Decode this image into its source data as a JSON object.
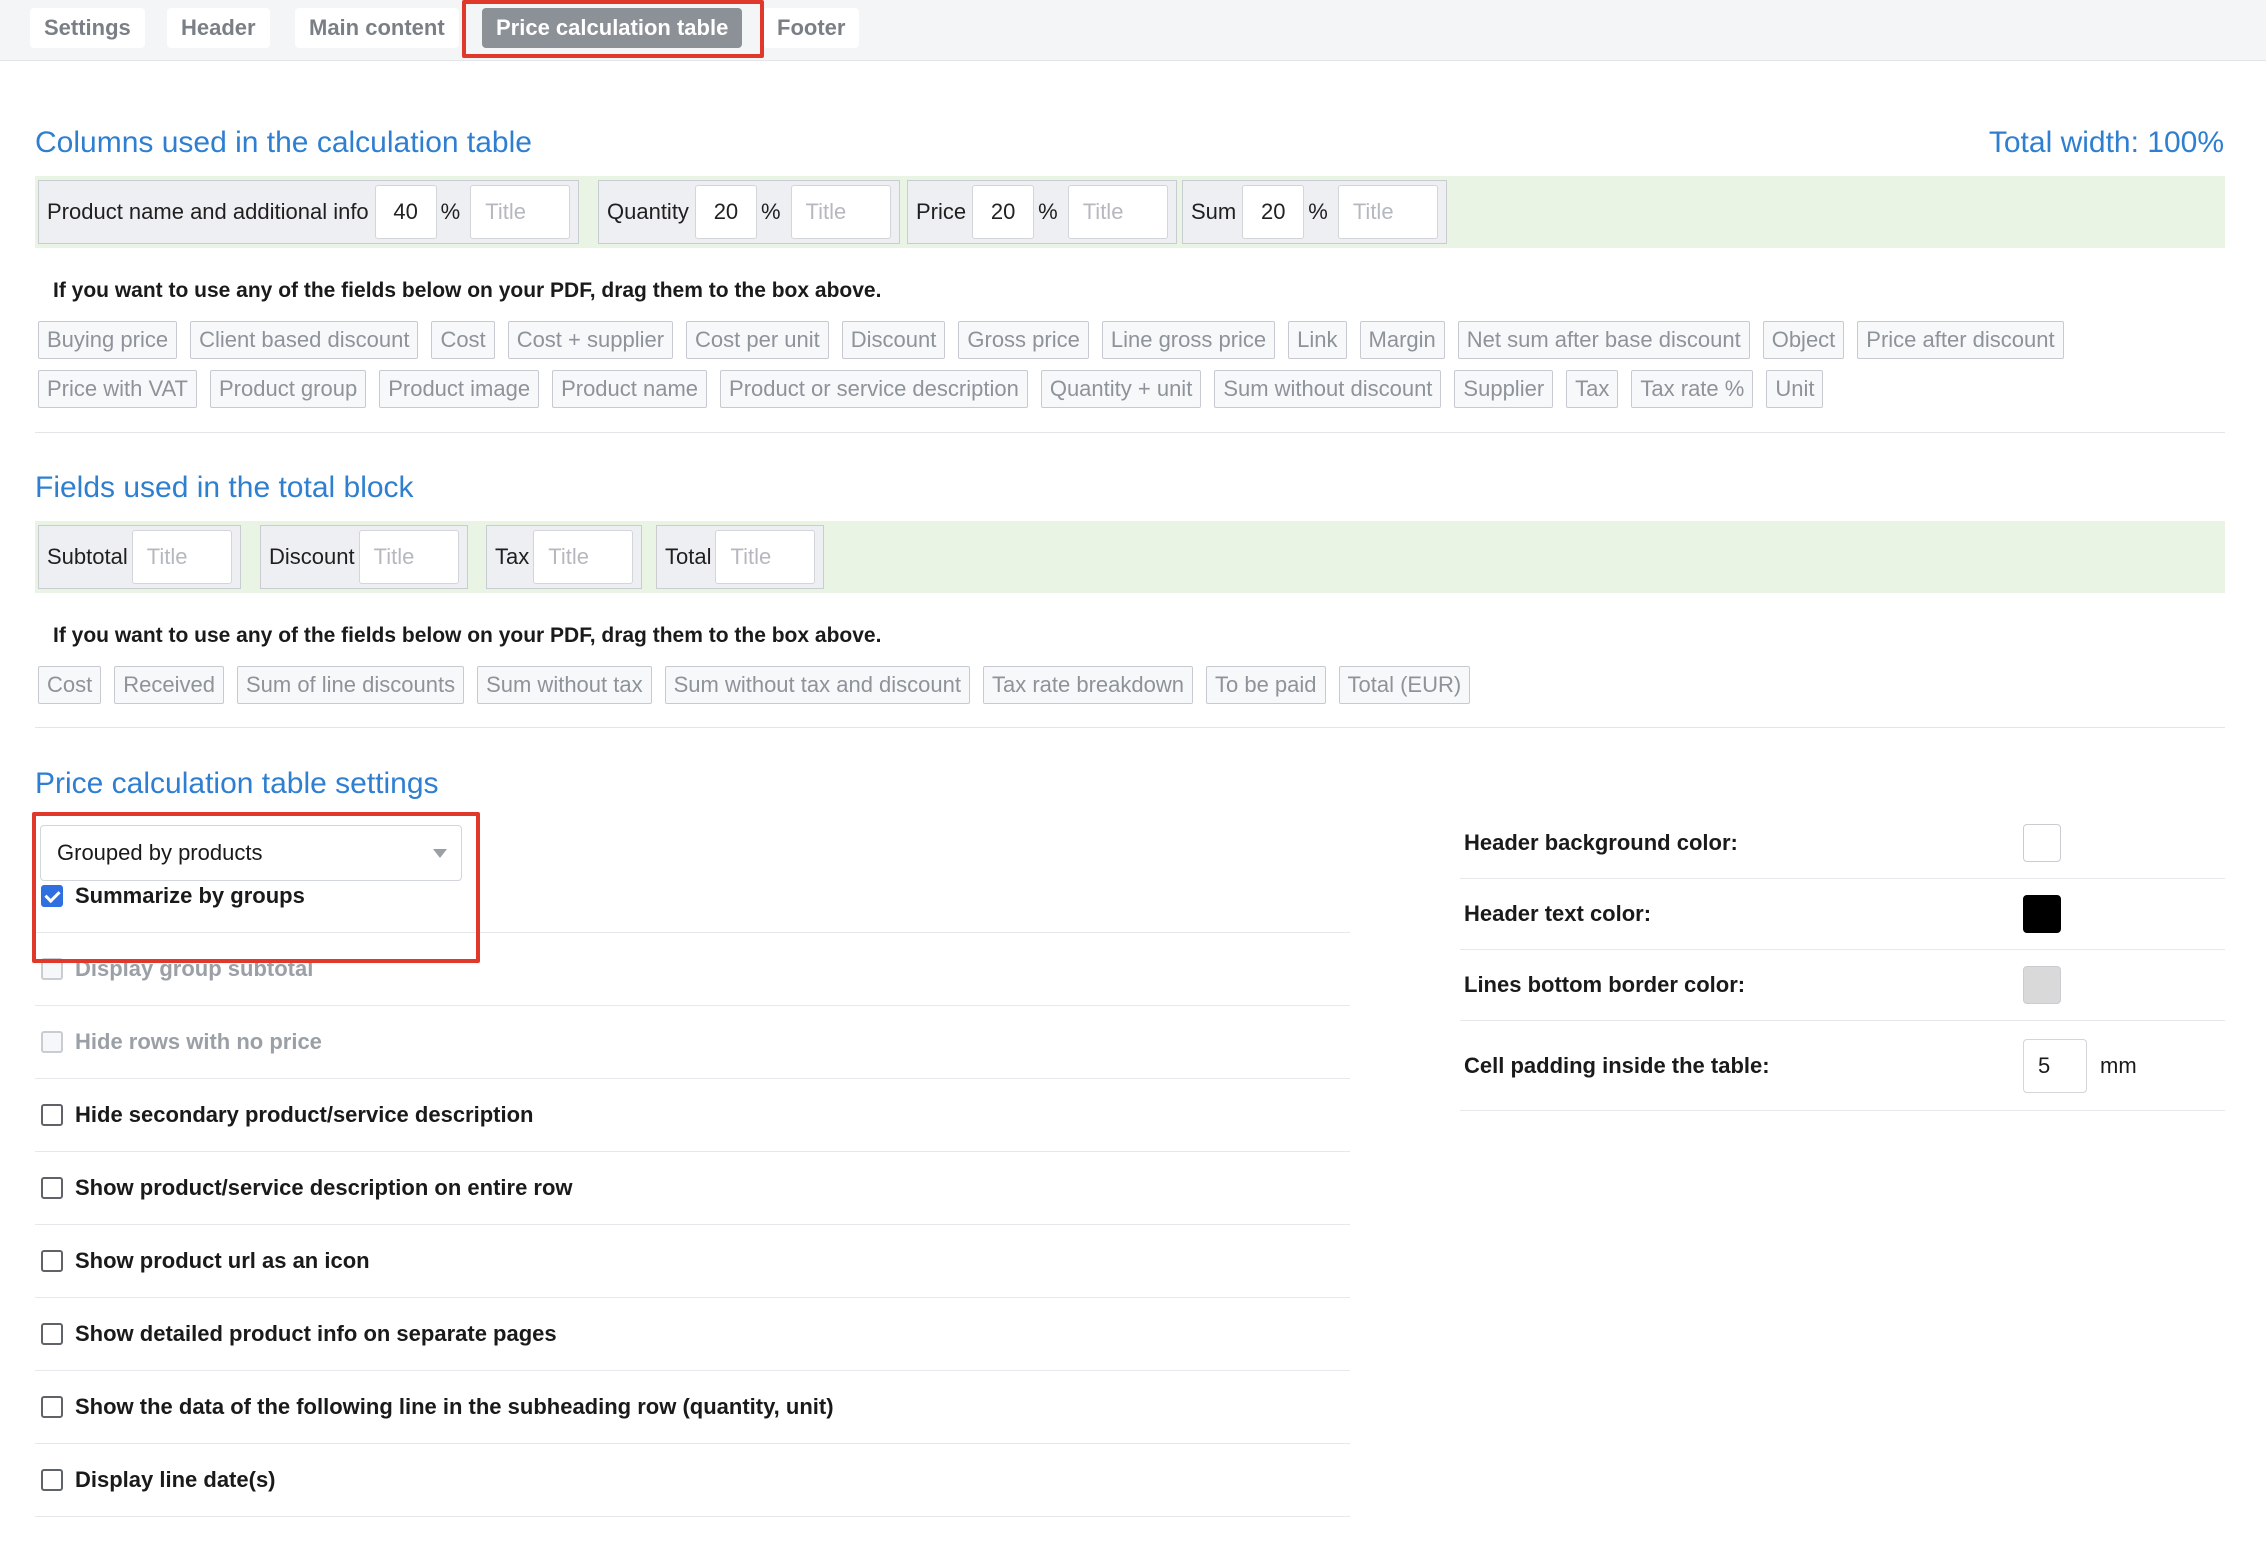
{
  "tabs": [
    {
      "label": "Settings"
    },
    {
      "label": "Header"
    },
    {
      "label": "Main content"
    },
    {
      "label": "Price calculation table",
      "active": true
    },
    {
      "label": "Footer"
    }
  ],
  "columns_section": {
    "heading": "Columns used in the calculation table",
    "total_width": "Total width: 100%",
    "columns": [
      {
        "label": "Product name and additional info",
        "width": "40",
        "unit": "%",
        "title_placeholder": "Title"
      },
      {
        "label": "Quantity",
        "width": "20",
        "unit": "%",
        "title_placeholder": "Title"
      },
      {
        "label": "Price",
        "width": "20",
        "unit": "%",
        "title_placeholder": "Title"
      },
      {
        "label": "Sum",
        "width": "20",
        "unit": "%",
        "title_placeholder": "Title"
      }
    ],
    "hint": "If you want to use any of the fields below on your PDF, drag them to the box above.",
    "available_row1": [
      "Buying price",
      "Client based discount",
      "Cost",
      "Cost + supplier",
      "Cost per unit",
      "Discount",
      "Gross price",
      "Line gross price",
      "Link",
      "Margin",
      "Net sum after base discount",
      "Object",
      "Price after discount"
    ],
    "available_row2": [
      "Price with VAT",
      "Product group",
      "Product image",
      "Product name",
      "Product or service description",
      "Quantity + unit",
      "Sum without discount",
      "Supplier",
      "Tax",
      "Tax rate %",
      "Unit"
    ]
  },
  "totals_section": {
    "heading": "Fields used in the total block",
    "fields": [
      {
        "label": "Subtotal",
        "title_placeholder": "Title"
      },
      {
        "label": "Discount",
        "title_placeholder": "Title"
      },
      {
        "label": "Tax",
        "title_placeholder": "Title"
      },
      {
        "label": "Total",
        "title_placeholder": "Title"
      }
    ],
    "hint": "If you want to use any of the fields below on your PDF, drag them to the box above.",
    "available": [
      "Cost",
      "Received",
      "Sum of line discounts",
      "Sum without tax",
      "Sum without tax and discount",
      "Tax rate breakdown",
      "To be paid",
      "Total (EUR)"
    ]
  },
  "settings_section": {
    "heading": "Price calculation table settings",
    "grouping_select": "Grouped by products",
    "options": [
      {
        "label": "Summarize by groups",
        "checked": true,
        "disabled": false
      },
      {
        "label": "Display group subtotal",
        "checked": false,
        "disabled": true
      },
      {
        "label": "Hide rows with no price",
        "checked": false,
        "disabled": true
      },
      {
        "label": "Hide secondary product/service description",
        "checked": false,
        "disabled": false
      },
      {
        "label": "Show product/service description on entire row",
        "checked": false,
        "disabled": false
      },
      {
        "label": "Show product url as an icon",
        "checked": false,
        "disabled": false
      },
      {
        "label": "Show detailed product info on separate pages",
        "checked": false,
        "disabled": false
      },
      {
        "label": "Show the data of the following line in the subheading row (quantity, unit)",
        "checked": false,
        "disabled": false
      },
      {
        "label": "Display line date(s)",
        "checked": false,
        "disabled": false
      }
    ],
    "header_bg_label": "Header background color:",
    "header_bg_color": "#ffffff",
    "header_text_label": "Header text color:",
    "header_text_color": "#000000",
    "lines_border_label": "Lines bottom border color:",
    "lines_border_color": "#d9d9d9",
    "cell_padding_label": "Cell padding inside the table:",
    "cell_padding_value": "5",
    "cell_padding_unit": "mm"
  },
  "colors": {
    "accent": "#2f7fd1",
    "highlight": "#e0392b",
    "dropzone": "#e9f4e4",
    "checkbox_checked": "#2f6fe0"
  }
}
